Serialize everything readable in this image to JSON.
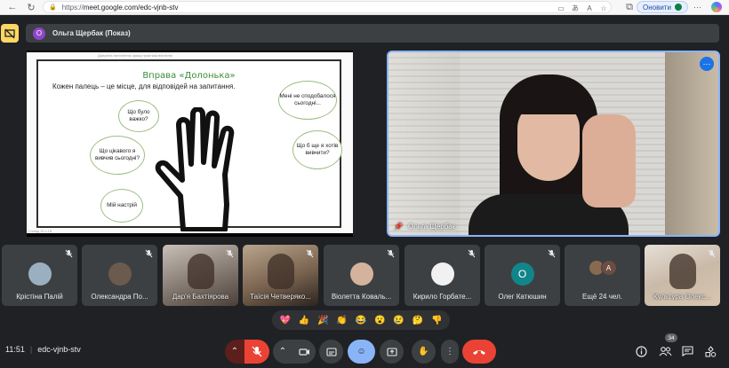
{
  "browser": {
    "url_proto": "https://",
    "url_rest": "meet.google.com/edc-vjnb-stv",
    "update_label": "Оновити"
  },
  "presenter_bar": {
    "avatar_letter": "О",
    "label": "Ольга Щербак (Показ)"
  },
  "slide": {
    "header": "Джерела натхнення: кращі практики вчителів",
    "title": "Вправа «Долонька»",
    "subtitle": "Кожен палець – це місце, для відповідей на запитання.",
    "bubbles": {
      "b1": "Що було важко?",
      "b2": "Що цікавого я вивчив сьогодні?",
      "b3": "Мій настрій",
      "b4": "Мені не сподобалося сьогодні...",
      "b5": "Що б ще я хотів вивчити?"
    },
    "footer": "Слайд 15 з 18"
  },
  "main_video": {
    "name": "Ольга Щербак"
  },
  "participants": [
    {
      "name": "Крістіна Палій",
      "kind": "avatar",
      "color": "#9ab0c0"
    },
    {
      "name": "Олександра По...",
      "kind": "avatar",
      "color": "#6b5a4e"
    },
    {
      "name": "Дар'я Бахтіярова",
      "kind": "camera"
    },
    {
      "name": "Таїсія Четверяко...",
      "kind": "camera"
    },
    {
      "name": "Віолетта Коваль...",
      "kind": "avatar",
      "color": "#d4b39c"
    },
    {
      "name": "Кирило Горбате...",
      "kind": "avatar",
      "color": "#f1f1f1"
    },
    {
      "name": "Олег Катюшин",
      "kind": "letter",
      "letter": "О"
    },
    {
      "name": "Ещё 24 чел.",
      "kind": "more",
      "letter": "А"
    },
    {
      "name": "Культура Олекс...",
      "kind": "camera"
    }
  ],
  "reactions": [
    "💖",
    "👍",
    "🎉",
    "👏",
    "😂",
    "😮",
    "😢",
    "🤔",
    "👎"
  ],
  "bottom": {
    "time": "11:51",
    "meeting_code": "edc-vjnb-stv",
    "people_count": "34"
  }
}
